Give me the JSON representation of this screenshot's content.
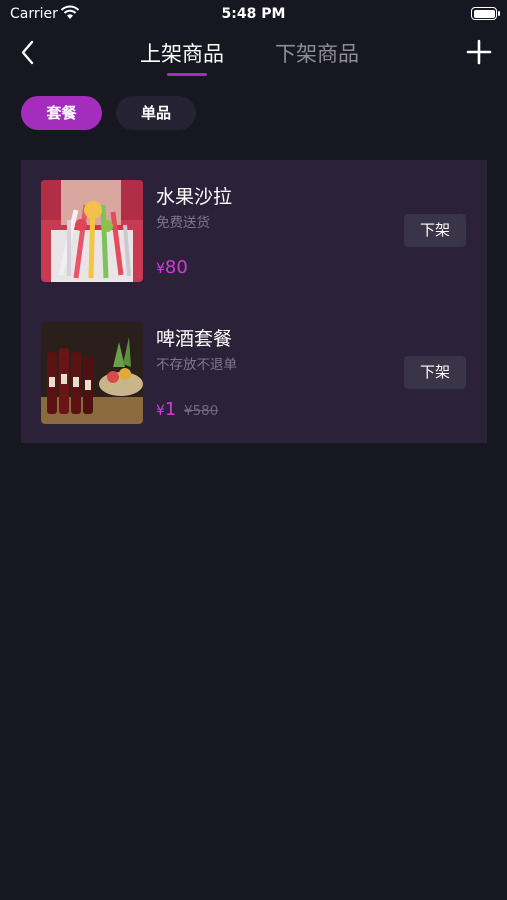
{
  "status_bar": {
    "carrier": "Carrier",
    "time": "5:48 PM"
  },
  "nav": {
    "tabs": [
      {
        "label": "上架商品",
        "active": true
      },
      {
        "label": "下架商品",
        "active": false
      }
    ]
  },
  "filters": [
    {
      "label": "套餐",
      "active": true
    },
    {
      "label": "单品",
      "active": false
    }
  ],
  "products": [
    {
      "name": "水果沙拉",
      "description": "免费送货",
      "price_symbol": "¥",
      "price": "80",
      "action_label": "下架"
    },
    {
      "name": "啤酒套餐",
      "description": "不存放不退单",
      "price_symbol": "¥",
      "price": "1",
      "original_price": "¥580",
      "action_label": "下架"
    }
  ],
  "colors": {
    "accent": "#a52dbd",
    "price": "#d03ad6",
    "background": "#171722",
    "panel": "#2b2239"
  }
}
